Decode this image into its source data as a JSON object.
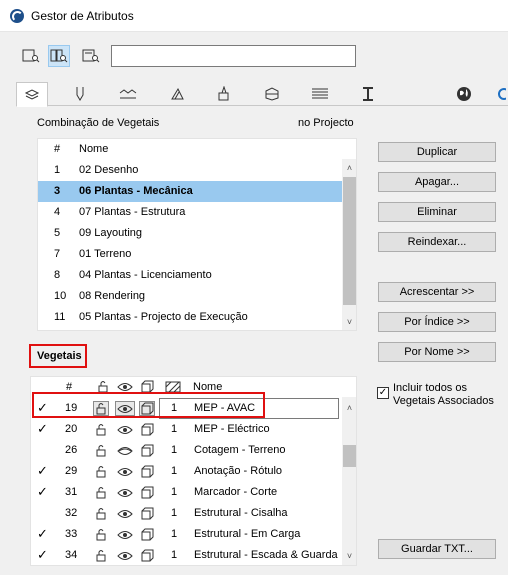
{
  "window": {
    "title": "Gestor de Atributos"
  },
  "top_list": {
    "type_label": "Combinação de Vegetais",
    "location_label": "no Projecto",
    "headers": {
      "num": "#",
      "name": "Nome"
    },
    "rows": [
      {
        "num": "1",
        "name": "02 Desenho"
      },
      {
        "num": "3",
        "name": "06 Plantas - Mecânica",
        "selected": true
      },
      {
        "num": "4",
        "name": "07 Plantas - Estrutura"
      },
      {
        "num": "5",
        "name": "09 Layouting"
      },
      {
        "num": "7",
        "name": "01 Terreno"
      },
      {
        "num": "8",
        "name": "04 Plantas - Licenciamento"
      },
      {
        "num": "10",
        "name": "08 Rendering"
      },
      {
        "num": "11",
        "name": "05 Plantas - Projecto de Execução"
      }
    ]
  },
  "bottom_list": {
    "section_label": "Vegetais",
    "headers": {
      "num": "#",
      "name": "Nome"
    },
    "rows": [
      {
        "checked": true,
        "num": "19",
        "pen": "1",
        "name": "MEP - AVAC",
        "visible": true,
        "selected": true
      },
      {
        "checked": true,
        "num": "20",
        "pen": "1",
        "name": "MEP - Eléctrico",
        "visible": true
      },
      {
        "checked": false,
        "num": "26",
        "pen": "1",
        "name": "Cotagem - Terreno",
        "visible": false
      },
      {
        "checked": true,
        "num": "29",
        "pen": "1",
        "name": "Anotação - Rótulo",
        "visible": true
      },
      {
        "checked": true,
        "num": "31",
        "pen": "1",
        "name": "Marcador - Corte",
        "visible": true
      },
      {
        "checked": false,
        "num": "32",
        "pen": "1",
        "name": "Estrutural - Cisalha",
        "visible": true
      },
      {
        "checked": true,
        "num": "33",
        "pen": "1",
        "name": "Estrutural - Em Carga",
        "visible": true
      },
      {
        "checked": true,
        "num": "34",
        "pen": "1",
        "name": "Estrutural - Escada & Guarda",
        "visible": true
      }
    ]
  },
  "buttons": {
    "duplicate": "Duplicar",
    "delete_ellipsis": "Apagar...",
    "remove": "Eliminar",
    "reindex": "Reindexar...",
    "add": "Acrescentar >>",
    "by_index": "Por Índice >>",
    "by_name": "Por Nome >>",
    "save_txt": "Guardar TXT..."
  },
  "include_checkbox": {
    "label_line1": "Incluir todos os",
    "label_line2": "Vegetais Associados",
    "checked": true
  },
  "icons": {
    "view_modes": [
      "list-view-icon",
      "split-view-icon",
      "detail-view-icon"
    ],
    "tabs": [
      "layers-icon",
      "pen-icon",
      "line-type-icon",
      "fill-icon",
      "surface-icon",
      "building-material-icon",
      "composite-icon",
      "profile-icon",
      "globe-icon"
    ]
  }
}
